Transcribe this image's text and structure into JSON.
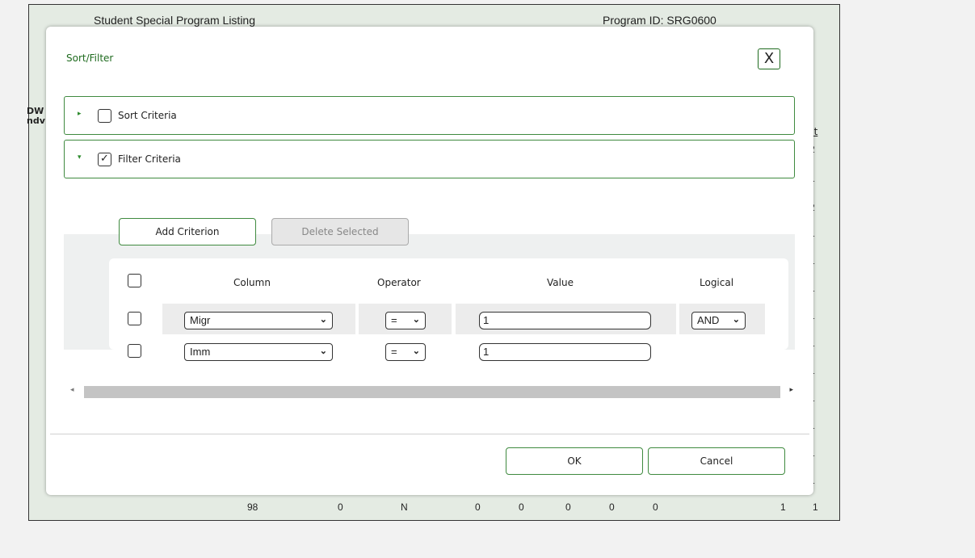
{
  "background_report": {
    "title": "Student Special Program Listing",
    "program_id": "Program ID:  SRG0600",
    "left_header_fragment": [
      "DW",
      "ndv"
    ],
    "right_header_fragment": "ct",
    "right_column_values": [
      "2",
      "1",
      "2",
      "1",
      "1",
      "1",
      "1",
      "1",
      "1",
      "1",
      "1",
      "1",
      "1"
    ],
    "bottom_row": [
      "98",
      "0",
      "N",
      "0",
      "0",
      "0",
      "0",
      "0",
      "1",
      "1"
    ]
  },
  "modal": {
    "title": "Sort/Filter",
    "close_label": "X",
    "sections": [
      {
        "label": "Sort Criteria",
        "arrow": "▸",
        "checked": ""
      },
      {
        "label": "Filter Criteria",
        "arrow": "▾",
        "checked": "✓"
      }
    ],
    "buttons": {
      "add": "Add Criterion",
      "delete": "Delete Selected",
      "ok": "OK",
      "cancel": "Cancel"
    },
    "grid": {
      "headers": {
        "column": "Column",
        "operator": "Operator",
        "value": "Value",
        "logical": "Logical"
      },
      "rows": [
        {
          "column": "Migr",
          "operator": "=",
          "value": "1",
          "logical": "AND"
        },
        {
          "column": "Imm",
          "operator": "=",
          "value": "1",
          "logical": ""
        }
      ]
    },
    "scrollbar": {
      "left_arrow": "◂",
      "right_arrow": "▸"
    }
  },
  "colors": {
    "accent_green": "#3f8a3f",
    "report_bg": "#e4ebe3"
  },
  "icons": [
    "close-icon",
    "expand-arrow-icon",
    "collapse-arrow-icon",
    "chevron-down-icon",
    "checkmark-icon"
  ]
}
